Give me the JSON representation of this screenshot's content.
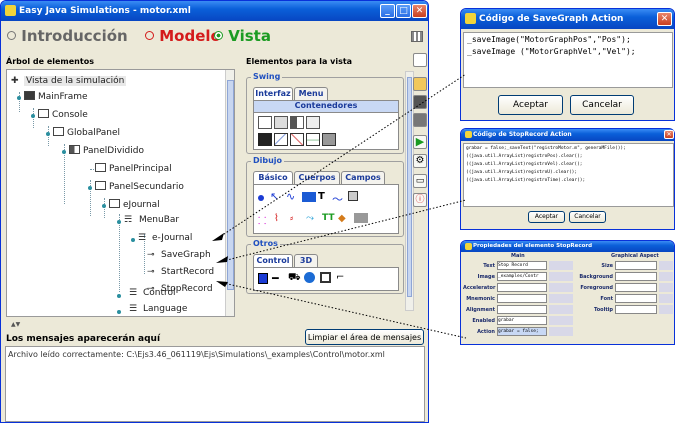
{
  "main_window": {
    "title": "Easy Java Simulations - motor.xml",
    "radio_tabs": [
      {
        "label": "Introducción",
        "selected": false
      },
      {
        "label": "Modelo",
        "selected": false
      },
      {
        "label": "Vista",
        "selected": true
      }
    ],
    "tree_panel_title": "Árbol de elementos",
    "tree_items": [
      "Vista de la simulación",
      "MainFrame",
      "Console",
      "GlobalPanel",
      "PanelDividido",
      "PanelPrincipal",
      "PanelSecundario",
      "eJournal",
      "MenuBar",
      "e-Journal",
      "SaveGraph",
      "StartRecord",
      "StopRecord",
      "Control",
      "Language"
    ],
    "elements_panel_title": "Elementos para la vista",
    "swing": {
      "label": "Swing",
      "tabs": [
        "Interfaz",
        "Menu"
      ],
      "subtab": "Contenedores"
    },
    "dibujo": {
      "label": "Dibujo",
      "tabs": [
        "Básico",
        "Cuerpos",
        "Campos"
      ]
    },
    "otros": {
      "label": "Otros",
      "tabs": [
        "Control",
        "3D"
      ]
    },
    "messages": {
      "title": "Los mensajes aparecerán aquí",
      "clear_button": "Limpiar el área de mensajes",
      "text": "Archivo leído correctamente: C:\\Ejs3.46_061119\\Ejs\\Simulations\\_examples\\Control\\motor.xml"
    }
  },
  "dialog_savegraph": {
    "title": "Código de SaveGraph Action",
    "code_lines": [
      "_saveImage(\"MotorGraphPos\",\"Pos\");",
      "_saveImage (\"MotorGraphVel\",\"Vel\");"
    ],
    "accept": "Aceptar",
    "cancel": "Cancelar"
  },
  "dialog_stoprecord": {
    "title": "Código de StopRecord Action",
    "code_lines": [
      "grabar = false;_saveText(\"registroMotor.m\", generaMFile());",
      "((java.util.ArrayList)registroPos).clear();",
      "((java.util.ArrayList)registroVel).clear();",
      "((java.util.ArrayList)registroU).clear();",
      "((java.util.ArrayList)registroTime).clear();"
    ],
    "accept": "Aceptar",
    "cancel": "Cancelar"
  },
  "dialog_properties": {
    "title": "Propiedades del elemento StopRecord",
    "col_main": "Main",
    "col_graphical": "Graphical Aspect",
    "rows_left": [
      {
        "label": "Text",
        "value": "Stop Record"
      },
      {
        "label": "Image",
        "value": "_examples/Contr"
      },
      {
        "label": "Accelerator",
        "value": ""
      },
      {
        "label": "Mnemonic",
        "value": ""
      },
      {
        "label": "Alignment",
        "value": ""
      },
      {
        "label": "Enabled",
        "value": "grabar"
      },
      {
        "label": "Action",
        "value": "grabar = false;"
      }
    ],
    "rows_right": [
      "Size",
      "Background",
      "Foreground",
      "Font",
      "Tooltip"
    ]
  }
}
